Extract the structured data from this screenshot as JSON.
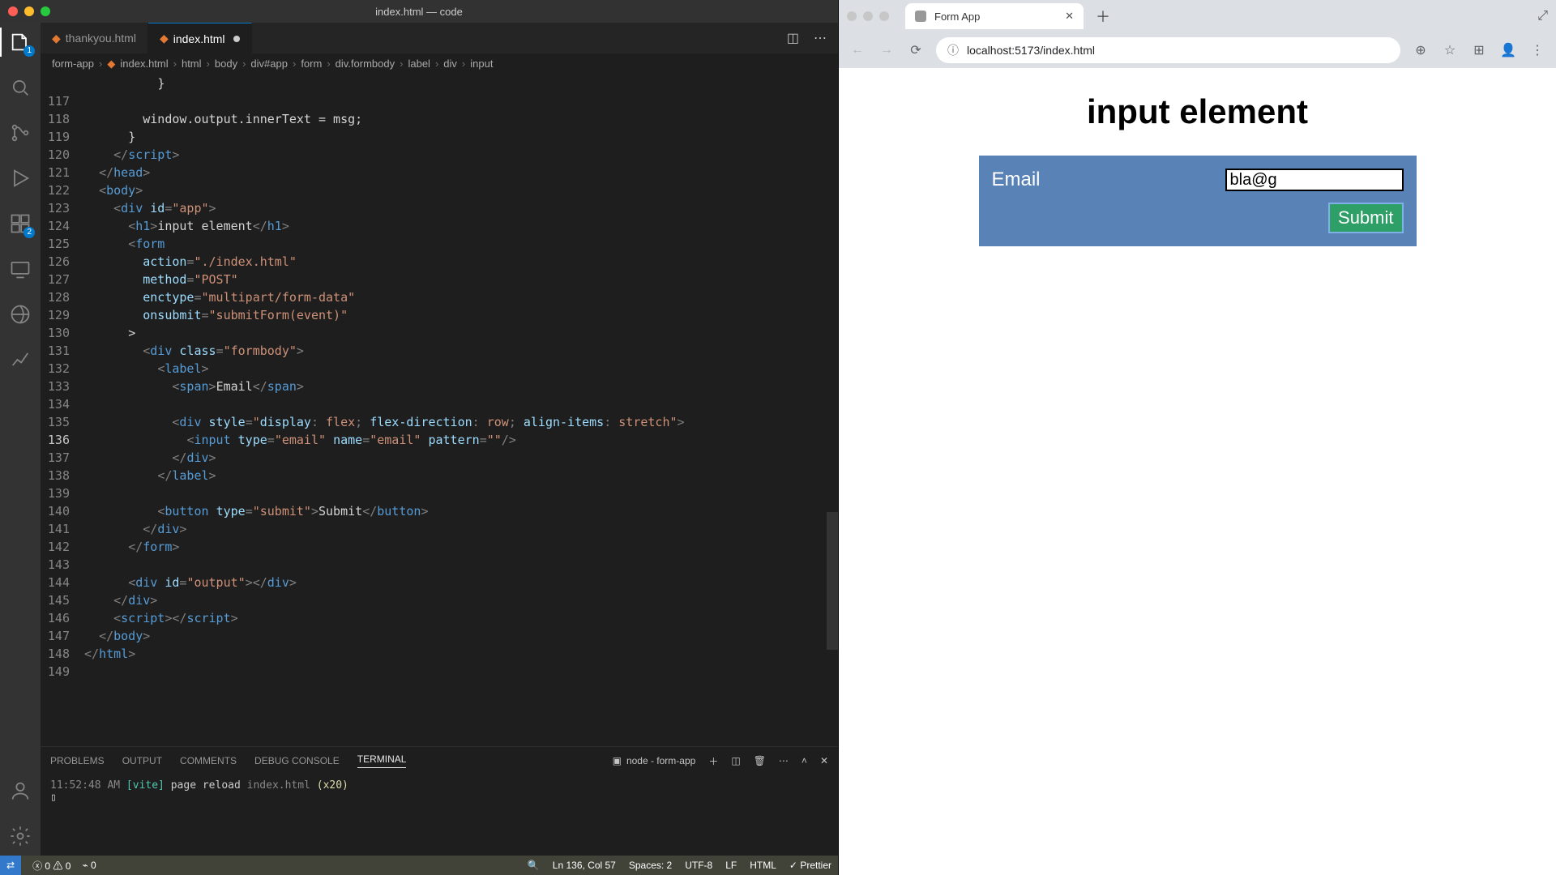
{
  "window": {
    "title": "index.html — code"
  },
  "tabs": [
    {
      "label": "thankyou.html",
      "active": false,
      "dirty": false
    },
    {
      "label": "index.html",
      "active": true,
      "dirty": true
    }
  ],
  "breadcrumb": [
    "form-app",
    "index.html",
    "html",
    "body",
    "div#app",
    "form",
    "div.formbody",
    "label",
    "div",
    "input"
  ],
  "activity_badges": {
    "explorer": "1",
    "extensions": "2"
  },
  "gutter_start": 116,
  "gutter_blank_first": true,
  "cursor_line": 136,
  "code_lines": [
    {
      "indent": 10,
      "raw": "}"
    },
    {
      "indent": 0,
      "empty": true
    },
    {
      "indent": 8,
      "raw": "window.output.innerText = msg;"
    },
    {
      "indent": 6,
      "raw": "}"
    },
    {
      "indent": 4,
      "tag_close": "script"
    },
    {
      "indent": 2,
      "tag_close": "head"
    },
    {
      "indent": 2,
      "tag_open": "body"
    },
    {
      "indent": 4,
      "tag_open": "div",
      "attrs": [
        [
          "id",
          "app"
        ]
      ]
    },
    {
      "indent": 6,
      "wrap": "h1",
      "text": "input element"
    },
    {
      "indent": 6,
      "tag_open": "form",
      "noclose": true
    },
    {
      "indent": 8,
      "attr_line": [
        "action",
        "./index.html"
      ]
    },
    {
      "indent": 8,
      "attr_line": [
        "method",
        "POST"
      ]
    },
    {
      "indent": 8,
      "attr_line": [
        "enctype",
        "multipart/form-data"
      ]
    },
    {
      "indent": 8,
      "attr_line": [
        "onsubmit",
        "submitForm(event)"
      ]
    },
    {
      "indent": 6,
      "raw": ">"
    },
    {
      "indent": 8,
      "tag_open": "div",
      "attrs": [
        [
          "class",
          "formbody"
        ]
      ]
    },
    {
      "indent": 10,
      "tag_open": "label"
    },
    {
      "indent": 12,
      "wrap": "span",
      "text": "Email"
    },
    {
      "indent": 0,
      "empty": true
    },
    {
      "indent": 12,
      "tag_open": "div",
      "attrs": [
        [
          "style",
          "display: flex; flex-direction: row; align-items: stretch"
        ]
      ],
      "style_hl": true
    },
    {
      "indent": 14,
      "self": "input",
      "attrs": [
        [
          "type",
          "email"
        ],
        [
          "name",
          "email"
        ],
        [
          "pattern",
          ""
        ]
      ]
    },
    {
      "indent": 12,
      "tag_close": "div"
    },
    {
      "indent": 10,
      "tag_close": "label"
    },
    {
      "indent": 0,
      "empty": true
    },
    {
      "indent": 10,
      "wrap": "button",
      "attrs": [
        [
          "type",
          "submit"
        ]
      ],
      "text": "Submit"
    },
    {
      "indent": 8,
      "tag_close": "div"
    },
    {
      "indent": 6,
      "tag_close": "form"
    },
    {
      "indent": 0,
      "empty": true
    },
    {
      "indent": 6,
      "wrap": "div",
      "attrs": [
        [
          "id",
          "output"
        ]
      ],
      "text": ""
    },
    {
      "indent": 4,
      "tag_close": "div"
    },
    {
      "indent": 4,
      "wrap": "script",
      "text": ""
    },
    {
      "indent": 2,
      "tag_close": "body"
    },
    {
      "indent": 0,
      "tag_close": "html"
    },
    {
      "indent": 0,
      "empty": true
    }
  ],
  "panel": {
    "tabs": [
      "PROBLEMS",
      "OUTPUT",
      "COMMENTS",
      "DEBUG CONSOLE",
      "TERMINAL"
    ],
    "active": "TERMINAL",
    "terminal_selector": "node - form-app",
    "terminal_line": {
      "time": "11:52:48 AM",
      "tag": "[vite]",
      "msg": "page reload",
      "file": "index.html",
      "extra": "(x20)"
    }
  },
  "status": {
    "errors": "0",
    "warnings": "0",
    "ports": "0",
    "ln": "Ln 136, Col 57",
    "spaces": "Spaces: 2",
    "enc": "UTF-8",
    "eol": "LF",
    "lang": "HTML",
    "prettier": "Prettier"
  },
  "browser": {
    "tab_title": "Form App",
    "url": "localhost:5173/index.html",
    "page_heading": "input element",
    "email_label": "Email",
    "email_value": "bla@g",
    "submit_label": "Submit"
  }
}
